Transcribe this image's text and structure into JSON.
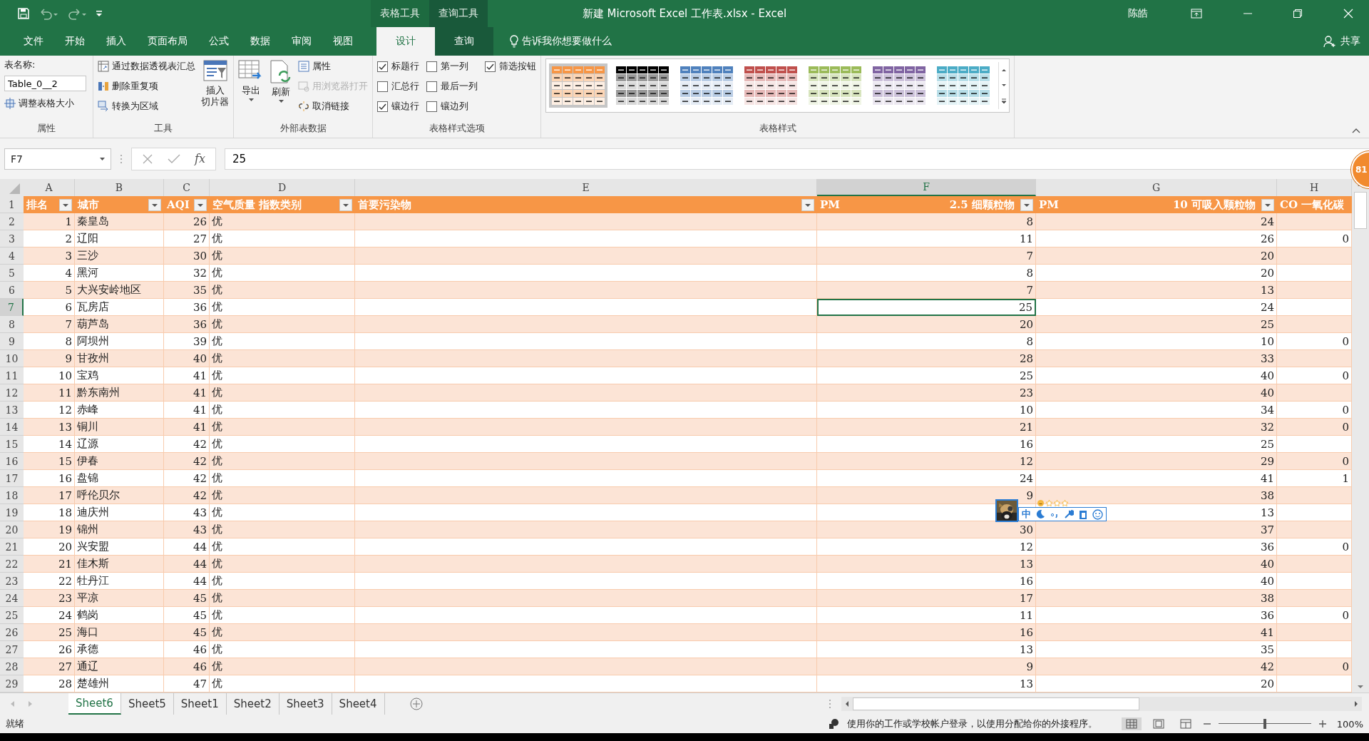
{
  "title_bar": {
    "context_tabs": [
      {
        "label": "表格工具",
        "kind": "table"
      },
      {
        "label": "查询工具",
        "kind": "query"
      }
    ],
    "title": "新建 Microsoft Excel 工作表.xlsx  -  Excel",
    "user": "陈皓"
  },
  "ribbon_tabs": [
    {
      "label": "文件",
      "selected": false,
      "kind": "normal"
    },
    {
      "label": "开始",
      "selected": false,
      "kind": "normal"
    },
    {
      "label": "插入",
      "selected": false,
      "kind": "normal"
    },
    {
      "label": "页面布局",
      "selected": false,
      "kind": "normal"
    },
    {
      "label": "公式",
      "selected": false,
      "kind": "normal"
    },
    {
      "label": "数据",
      "selected": false,
      "kind": "normal"
    },
    {
      "label": "审阅",
      "selected": false,
      "kind": "normal"
    },
    {
      "label": "视图",
      "selected": false,
      "kind": "normal"
    },
    {
      "label": "设计",
      "selected": true,
      "kind": "table"
    },
    {
      "label": "查询",
      "selected": false,
      "kind": "query"
    }
  ],
  "tell_me": "告诉我你想要做什么",
  "share": "共享",
  "ribbon": {
    "properties": {
      "table_name_label": "表名称:",
      "table_name": "Table_0__2",
      "resize": "调整表格大小",
      "group_label": "属性"
    },
    "tools": {
      "items": [
        "通过数据透视表汇总",
        "删除重复项",
        "转换为区域"
      ],
      "slicer_lines": [
        "插入",
        "切片器"
      ],
      "group_label": "工具"
    },
    "external": {
      "export": "导出",
      "refresh": "刷新",
      "items": [
        {
          "label": "属性",
          "disabled": false
        },
        {
          "label": "用浏览器打开",
          "disabled": true
        },
        {
          "label": "取消链接",
          "disabled": false
        }
      ],
      "group_label": "外部表数据"
    },
    "style_options": {
      "columns": [
        [
          {
            "label": "标题行",
            "checked": true
          },
          {
            "label": "汇总行",
            "checked": false
          },
          {
            "label": "镶边行",
            "checked": true
          }
        ],
        [
          {
            "label": "第一列",
            "checked": false
          },
          {
            "label": "最后一列",
            "checked": false
          },
          {
            "label": "镶边列",
            "checked": false
          }
        ],
        [
          {
            "label": "筛选按钮",
            "checked": true
          }
        ]
      ],
      "group_label": "表格样式选项"
    },
    "styles": {
      "swatches": [
        {
          "color": "#f79646",
          "selected": true
        },
        {
          "color": "#000000",
          "selected": false
        },
        {
          "color": "#4f81bd",
          "selected": false
        },
        {
          "color": "#c0504d",
          "selected": false
        },
        {
          "color": "#9bbb59",
          "selected": false
        },
        {
          "color": "#8064a2",
          "selected": false
        },
        {
          "color": "#4bacc6",
          "selected": false
        }
      ],
      "group_label": "表格样式"
    }
  },
  "formula_bar": {
    "name_box": "F7",
    "function_label": "fx",
    "formula": "25"
  },
  "columns": [
    {
      "letter": "A",
      "selected": false
    },
    {
      "letter": "B",
      "selected": false
    },
    {
      "letter": "C",
      "selected": false
    },
    {
      "letter": "D",
      "selected": false
    },
    {
      "letter": "E",
      "selected": false
    },
    {
      "letter": "F",
      "selected": true
    },
    {
      "letter": "G",
      "selected": false
    },
    {
      "letter": "H",
      "selected": false
    }
  ],
  "header_row": {
    "number": "1",
    "cells": [
      {
        "parts": [
          "排名"
        ],
        "filter": true
      },
      {
        "parts": [
          "城市"
        ],
        "filter": true
      },
      {
        "parts": [
          "AQI"
        ],
        "filter": true
      },
      {
        "parts": [
          "空气质量 指数类别"
        ],
        "filter": true
      },
      {
        "parts": [
          "首要污染物"
        ],
        "filter": true
      },
      {
        "parts": [
          "PM",
          "2.5 细颗粒物"
        ],
        "filter": true
      },
      {
        "parts": [
          "PM",
          "10 可吸入颗粒物"
        ],
        "filter": true
      },
      {
        "parts": [
          "CO 一氧化碳"
        ],
        "filter": false
      }
    ]
  },
  "rows": [
    {
      "number": "2",
      "selected": false,
      "cells": [
        "1",
        "秦皇岛",
        "26",
        "优",
        "",
        "8",
        "24",
        ""
      ]
    },
    {
      "number": "3",
      "selected": false,
      "cells": [
        "2",
        "辽阳",
        "27",
        "优",
        "",
        "11",
        "26",
        "0"
      ]
    },
    {
      "number": "4",
      "selected": false,
      "cells": [
        "3",
        "三沙",
        "30",
        "优",
        "",
        "7",
        "20",
        ""
      ]
    },
    {
      "number": "5",
      "selected": false,
      "cells": [
        "4",
        "黑河",
        "32",
        "优",
        "",
        "8",
        "20",
        ""
      ]
    },
    {
      "number": "6",
      "selected": false,
      "cells": [
        "5",
        "大兴安岭地区",
        "35",
        "优",
        "",
        "7",
        "13",
        ""
      ]
    },
    {
      "number": "7",
      "selected": true,
      "cells": [
        "6",
        "瓦房店",
        "36",
        "优",
        "",
        "25",
        "24",
        ""
      ]
    },
    {
      "number": "8",
      "selected": false,
      "cells": [
        "7",
        "葫芦岛",
        "36",
        "优",
        "",
        "20",
        "25",
        ""
      ]
    },
    {
      "number": "9",
      "selected": false,
      "cells": [
        "8",
        "阿坝州",
        "39",
        "优",
        "",
        "8",
        "10",
        "0"
      ]
    },
    {
      "number": "10",
      "selected": false,
      "cells": [
        "9",
        "甘孜州",
        "40",
        "优",
        "",
        "28",
        "33",
        ""
      ]
    },
    {
      "number": "11",
      "selected": false,
      "cells": [
        "10",
        "宝鸡",
        "41",
        "优",
        "",
        "25",
        "40",
        "0"
      ]
    },
    {
      "number": "12",
      "selected": false,
      "cells": [
        "11",
        "黔东南州",
        "41",
        "优",
        "",
        "23",
        "40",
        ""
      ]
    },
    {
      "number": "13",
      "selected": false,
      "cells": [
        "12",
        "赤峰",
        "41",
        "优",
        "",
        "10",
        "34",
        "0"
      ]
    },
    {
      "number": "14",
      "selected": false,
      "cells": [
        "13",
        "铜川",
        "41",
        "优",
        "",
        "21",
        "32",
        "0"
      ]
    },
    {
      "number": "15",
      "selected": false,
      "cells": [
        "14",
        "辽源",
        "42",
        "优",
        "",
        "16",
        "25",
        ""
      ]
    },
    {
      "number": "16",
      "selected": false,
      "cells": [
        "15",
        "伊春",
        "42",
        "优",
        "",
        "12",
        "29",
        "0"
      ]
    },
    {
      "number": "17",
      "selected": false,
      "cells": [
        "16",
        "盘锦",
        "42",
        "优",
        "",
        "24",
        "41",
        "1"
      ]
    },
    {
      "number": "18",
      "selected": false,
      "cells": [
        "17",
        "呼伦贝尔",
        "42",
        "优",
        "",
        "9",
        "38",
        ""
      ]
    },
    {
      "number": "19",
      "selected": false,
      "cells": [
        "18",
        "迪庆州",
        "43",
        "优",
        "",
        "",
        "13",
        ""
      ]
    },
    {
      "number": "20",
      "selected": false,
      "cells": [
        "19",
        "锦州",
        "43",
        "优",
        "",
        "30",
        "37",
        ""
      ]
    },
    {
      "number": "21",
      "selected": false,
      "cells": [
        "20",
        "兴安盟",
        "44",
        "优",
        "",
        "12",
        "36",
        "0"
      ]
    },
    {
      "number": "22",
      "selected": false,
      "cells": [
        "21",
        "佳木斯",
        "44",
        "优",
        "",
        "13",
        "40",
        ""
      ]
    },
    {
      "number": "23",
      "selected": false,
      "cells": [
        "22",
        "牡丹江",
        "44",
        "优",
        "",
        "16",
        "40",
        ""
      ]
    },
    {
      "number": "24",
      "selected": false,
      "cells": [
        "23",
        "平凉",
        "45",
        "优",
        "",
        "17",
        "38",
        ""
      ]
    },
    {
      "number": "25",
      "selected": false,
      "cells": [
        "24",
        "鹤岗",
        "45",
        "优",
        "",
        "11",
        "36",
        "0"
      ]
    },
    {
      "number": "26",
      "selected": false,
      "cells": [
        "25",
        "海口",
        "45",
        "优",
        "",
        "16",
        "41",
        ""
      ]
    },
    {
      "number": "27",
      "selected": false,
      "cells": [
        "26",
        "承德",
        "46",
        "优",
        "",
        "13",
        "35",
        ""
      ]
    },
    {
      "number": "28",
      "selected": false,
      "cells": [
        "27",
        "通辽",
        "46",
        "优",
        "",
        "9",
        "42",
        "0"
      ]
    },
    {
      "number": "29",
      "selected": false,
      "cells": [
        "28",
        "楚雄州",
        "47",
        "优",
        "",
        "13",
        "20",
        ""
      ]
    }
  ],
  "badge": "81",
  "ime_toolbar": {
    "mode": "中"
  },
  "sheet_tabs": [
    {
      "label": "Sheet6",
      "selected": true
    },
    {
      "label": "Sheet5",
      "selected": false
    },
    {
      "label": "Sheet1",
      "selected": false
    },
    {
      "label": "Sheet2",
      "selected": false
    },
    {
      "label": "Sheet3",
      "selected": false
    },
    {
      "label": "Sheet4",
      "selected": false
    }
  ],
  "status_bar": {
    "status": "就绪",
    "message": "使用你的工作或学校帐户登录，以使用分配给你的外接程序。",
    "views": [
      {
        "kind": "normal",
        "selected": true
      },
      {
        "kind": "page_layout",
        "selected": false
      },
      {
        "kind": "page_break",
        "selected": false
      }
    ],
    "zoom": {
      "level": 0.5,
      "reading": "100%"
    }
  }
}
